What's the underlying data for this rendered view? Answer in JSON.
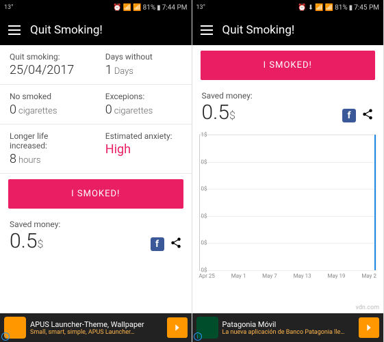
{
  "left": {
    "status": {
      "temp": "13°",
      "battery": "81%",
      "time": "7:44 PM"
    },
    "app_title": "Quit Smoking!",
    "stats": {
      "quit_label": "Quit smoking:",
      "quit_value": "25/04/2017",
      "days_label": "Days without",
      "days_value": "1",
      "days_unit": "Days",
      "nosmoked_label": "No smoked",
      "nosmoked_value": "0",
      "nosmoked_unit": "cigarettes",
      "exc_label": "Excepions:",
      "exc_value": "0",
      "exc_unit": "cigarettes",
      "life_label": "Longer life increased:",
      "life_value": "8",
      "life_unit": "hours",
      "anx_label": "Estimated anxiety:",
      "anx_value": "High"
    },
    "smoked_btn": "I SMOKED!",
    "saved_label": "Saved money:",
    "saved_value": "0.5",
    "saved_currency": "$",
    "ad": {
      "title": "APUS Launcher-Theme, Wallpaper",
      "sub": "Small, smart, simple, APUS Launcher…"
    }
  },
  "right": {
    "status": {
      "temp": "13°",
      "battery": "81%",
      "time": "7:45 PM"
    },
    "app_title": "Quit Smoking!",
    "smoked_btn": "I SMOKED!",
    "saved_label": "Saved money:",
    "saved_value": "0.5",
    "saved_currency": "$",
    "chart_data": {
      "type": "line",
      "x": [
        "Apr 25",
        "May 1",
        "May 7",
        "May 13",
        "May 19",
        "May 2"
      ],
      "yticks": [
        "1$",
        "0$",
        "0$",
        "0$",
        "0$",
        "0$"
      ],
      "ylabel": "",
      "xlabel": "",
      "ylim": [
        0,
        1
      ],
      "series": [
        {
          "name": "Saved money",
          "values": [
            0,
            0,
            0,
            0,
            0,
            1
          ]
        }
      ]
    },
    "ad": {
      "title": "Patagonia Móvil",
      "sub": "La nueva aplicación de Banco Patagonia lle…"
    }
  },
  "watermark": "vdn.com"
}
